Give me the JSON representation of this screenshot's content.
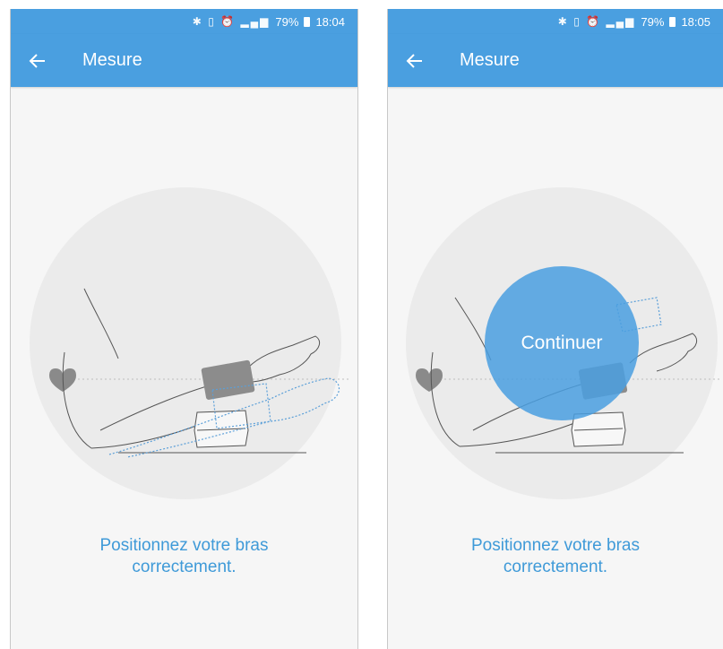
{
  "screens": [
    {
      "status": {
        "percent": "79%",
        "time": "18:04"
      },
      "header": {
        "title": "Mesure"
      },
      "instruction": {
        "line1": "Positionnez votre bras",
        "line2": "correctement."
      }
    },
    {
      "status": {
        "percent": "79%",
        "time": "18:05"
      },
      "header": {
        "title": "Mesure"
      },
      "continue_label": "Continuer",
      "instruction": {
        "line1": "Positionnez votre bras",
        "line2": "correctement."
      }
    }
  ],
  "icons": {
    "back": "arrow-left-icon",
    "heart": "heart-icon",
    "bluetooth": "bluetooth-icon",
    "vibrate": "vibrate-icon",
    "alarm": "alarm-icon",
    "signal": "signal-icon",
    "battery": "battery-icon"
  },
  "colors": {
    "primary": "#4a9fe0",
    "text_accent": "#3f9ad8",
    "background": "#f6f6f6",
    "circle": "#ebebeb"
  }
}
